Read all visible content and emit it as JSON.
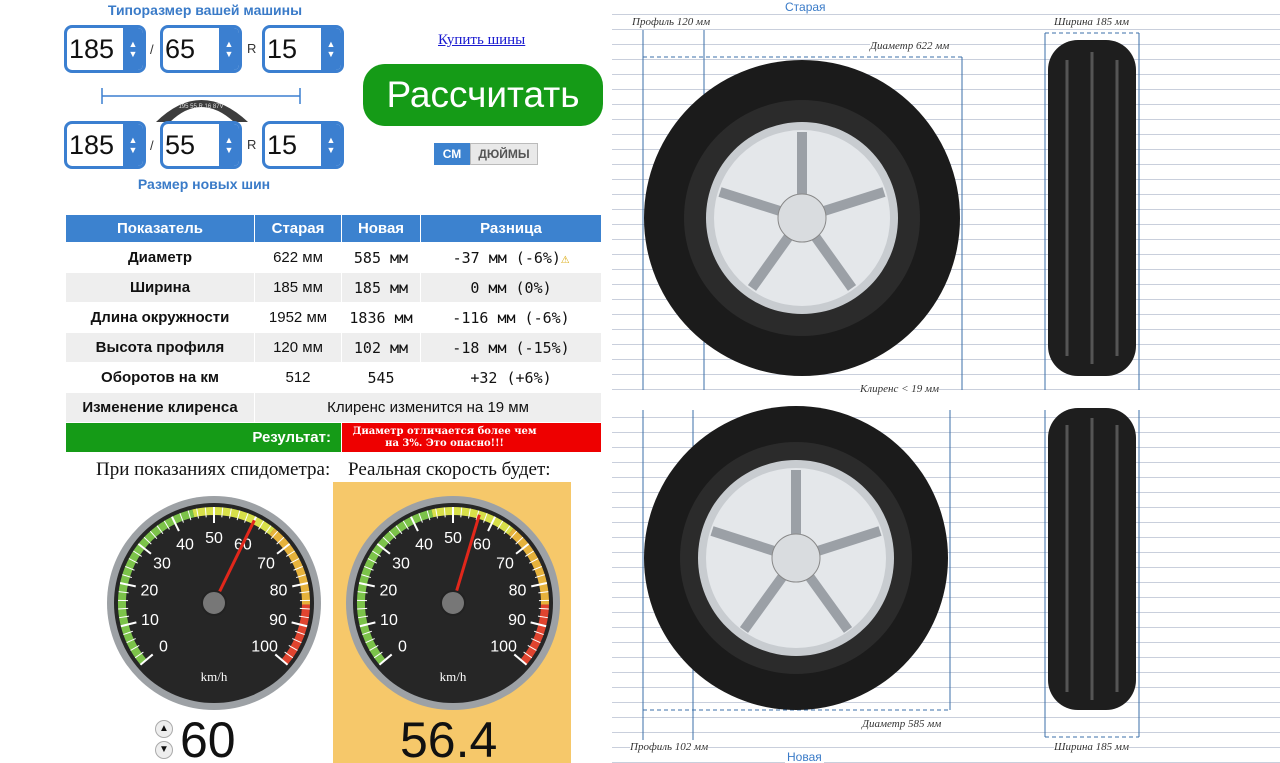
{
  "left": {
    "old_title": "Типоразмер вашей машины",
    "new_title": "Размер новых шин",
    "old": {
      "width": "185",
      "profile": "65",
      "rim": "15"
    },
    "new": {
      "width": "185",
      "profile": "55",
      "rim": "15"
    },
    "slash": "/",
    "r": "R",
    "tire_marking": "195 55 R 16 87V"
  },
  "actions": {
    "buy_link": "Купить шины",
    "calc_button": "Рассчитать",
    "unit_cm": "СМ",
    "unit_inch": "ДЮЙМЫ"
  },
  "table": {
    "headers": [
      "Показатель",
      "Старая",
      "Новая",
      "Разница"
    ],
    "rows": [
      {
        "label": "Диаметр",
        "old": "622 мм",
        "new": "585 мм",
        "diff": "-37 мм (-6%)",
        "warn": true
      },
      {
        "label": "Ширина",
        "old": "185 мм",
        "new": "185 мм",
        "diff": "0 мм (0%)"
      },
      {
        "label": "Длина окружности",
        "old": "1952 мм",
        "new": "1836 мм",
        "diff": "-116 мм (-6%)"
      },
      {
        "label": "Высота профиля",
        "old": "120 мм",
        "new": "102 мм",
        "diff": "-18 мм (-15%)"
      },
      {
        "label": "Оборотов на км",
        "old": "512",
        "new": "545",
        "diff": "+32 (+6%)"
      }
    ],
    "clearance_label": "Изменение клиренса",
    "clearance_value": "Клиренс изменится на 19 мм",
    "result_label": "Результат:",
    "result_value": "Диаметр отличается более чем на 3%. Это опасно!!!"
  },
  "speed": {
    "shown_label": "При показаниях спидометра:",
    "real_label": "Реальная скорость будет:",
    "shown_value": "60",
    "real_value": "56.4",
    "shown_speed": 60,
    "real_speed": 56.4,
    "unit": "km/h",
    "ticks": [
      "0",
      "10",
      "20",
      "30",
      "40",
      "50",
      "60",
      "70",
      "80",
      "90",
      "100"
    ]
  },
  "diagram": {
    "top_label": "Старая",
    "bottom_label": "Новая",
    "old_profile": "Профиль 120 мм",
    "old_width": "Ширина 185 мм",
    "old_diameter": "Диаметр 622 мм",
    "clearance": "Клиренс < 19 мм",
    "new_diameter": "Диаметр 585 мм",
    "new_profile": "Профиль 102 мм",
    "new_width": "Ширина 185 мм"
  },
  "colors": {
    "accent": "#3c82cf",
    "button": "#159b17",
    "danger": "#ee0000",
    "result_green": "#159b17",
    "highlight": "#f6c86a"
  }
}
